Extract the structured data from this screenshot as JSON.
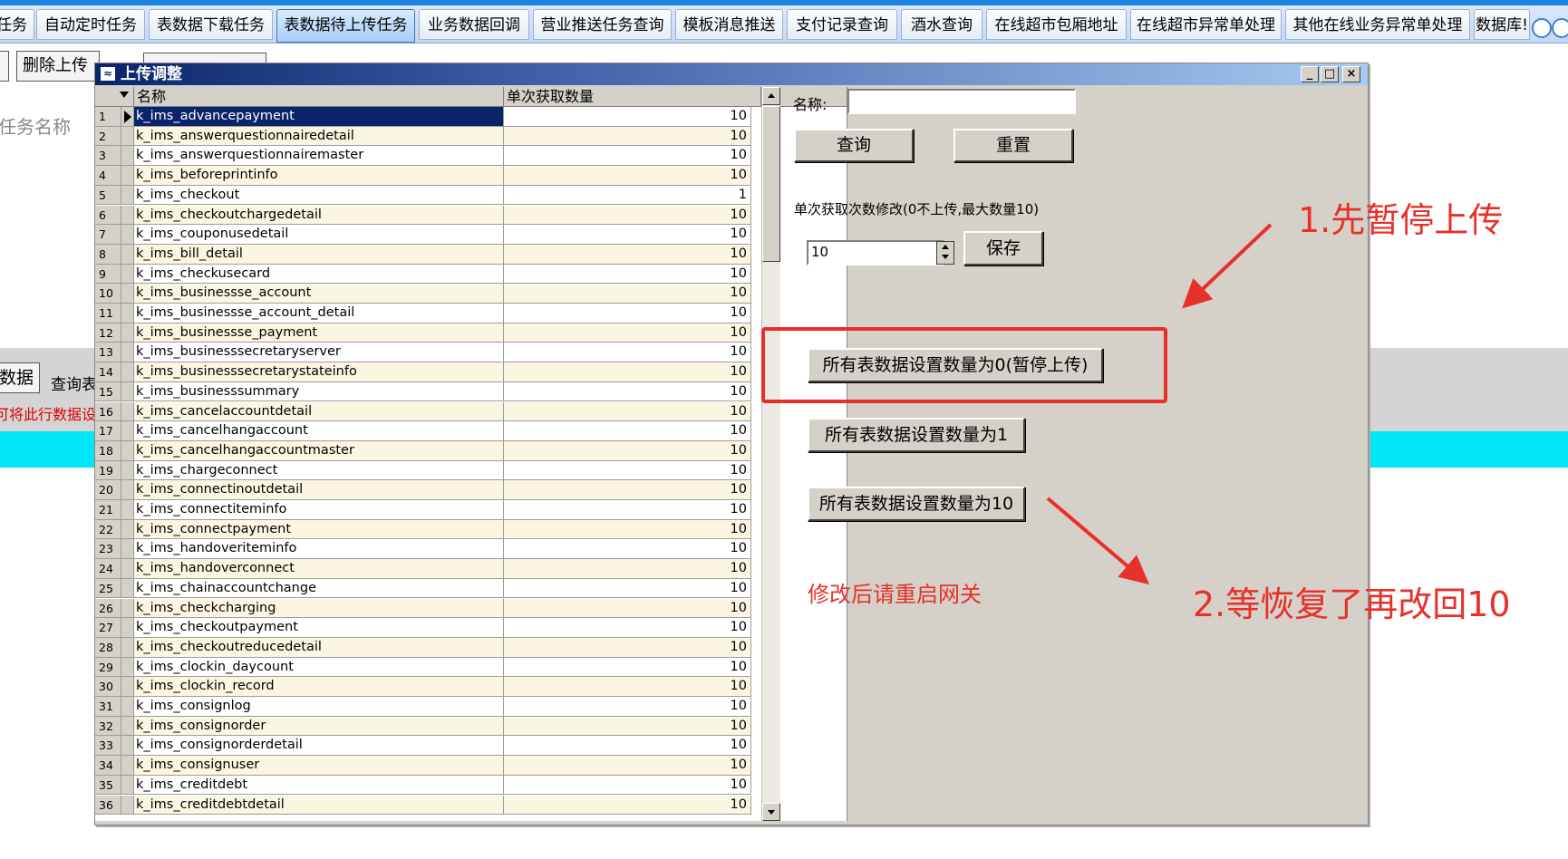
{
  "tabs": [
    {
      "label": "任务"
    },
    {
      "label": "自动定时任务"
    },
    {
      "label": "表数据下载任务"
    },
    {
      "label": "表数据待上传任务"
    },
    {
      "label": "业务数据回调"
    },
    {
      "label": "营业推送任务查询"
    },
    {
      "label": "模板消息推送"
    },
    {
      "label": "支付记录查询"
    },
    {
      "label": "酒水查询"
    },
    {
      "label": "在线超市包厢地址"
    },
    {
      "label": "在线超市异常单处理"
    },
    {
      "label": "其他在线业务异常单处理"
    },
    {
      "label": "数据库!"
    }
  ],
  "background": {
    "delete_upload_button": "删除上传",
    "task_name_label": "任务名称",
    "data_button": "数据",
    "query_table_text": "查询表",
    "warning_text": "可将此行数据设"
  },
  "dialog": {
    "title": "上传调整",
    "columns": {
      "name": "名称",
      "qty": "单次获取数量"
    },
    "rows": [
      {
        "no": "1",
        "name": "k_ims_advancepayment",
        "qty": "10"
      },
      {
        "no": "2",
        "name": "k_ims_answerquestionnairedetail",
        "qty": "10"
      },
      {
        "no": "3",
        "name": "k_ims_answerquestionnairemaster",
        "qty": "10"
      },
      {
        "no": "4",
        "name": "k_ims_beforeprintinfo",
        "qty": "10"
      },
      {
        "no": "5",
        "name": "k_ims_checkout",
        "qty": "1"
      },
      {
        "no": "6",
        "name": "k_ims_checkoutchargedetail",
        "qty": "10"
      },
      {
        "no": "7",
        "name": "k_ims_couponusedetail",
        "qty": "10"
      },
      {
        "no": "8",
        "name": "k_ims_bill_detail",
        "qty": "10"
      },
      {
        "no": "9",
        "name": "k_ims_checkusecard",
        "qty": "10"
      },
      {
        "no": "10",
        "name": "k_ims_businessse_account",
        "qty": "10"
      },
      {
        "no": "11",
        "name": "k_ims_businessse_account_detail",
        "qty": "10"
      },
      {
        "no": "12",
        "name": "k_ims_businessse_payment",
        "qty": "10"
      },
      {
        "no": "13",
        "name": "k_ims_businesssecretaryserver",
        "qty": "10"
      },
      {
        "no": "14",
        "name": "k_ims_businesssecretarystateinfo",
        "qty": "10"
      },
      {
        "no": "15",
        "name": "k_ims_businesssummary",
        "qty": "10"
      },
      {
        "no": "16",
        "name": "k_ims_cancelaccountdetail",
        "qty": "10"
      },
      {
        "no": "17",
        "name": "k_ims_cancelhangaccount",
        "qty": "10"
      },
      {
        "no": "18",
        "name": "k_ims_cancelhangaccountmaster",
        "qty": "10"
      },
      {
        "no": "19",
        "name": "k_ims_chargeconnect",
        "qty": "10"
      },
      {
        "no": "20",
        "name": "k_ims_connectinoutdetail",
        "qty": "10"
      },
      {
        "no": "21",
        "name": "k_ims_connectiteminfo",
        "qty": "10"
      },
      {
        "no": "22",
        "name": "k_ims_connectpayment",
        "qty": "10"
      },
      {
        "no": "23",
        "name": "k_ims_handoveriteminfo",
        "qty": "10"
      },
      {
        "no": "24",
        "name": "k_ims_handoverconnect",
        "qty": "10"
      },
      {
        "no": "25",
        "name": "k_ims_chainaccountchange",
        "qty": "10"
      },
      {
        "no": "26",
        "name": "k_ims_checkcharging",
        "qty": "10"
      },
      {
        "no": "27",
        "name": "k_ims_checkoutpayment",
        "qty": "10"
      },
      {
        "no": "28",
        "name": "k_ims_checkoutreducedetail",
        "qty": "10"
      },
      {
        "no": "29",
        "name": "k_ims_clockin_daycount",
        "qty": "10"
      },
      {
        "no": "30",
        "name": "k_ims_clockin_record",
        "qty": "10"
      },
      {
        "no": "31",
        "name": "k_ims_consignlog",
        "qty": "10"
      },
      {
        "no": "32",
        "name": "k_ims_consignorder",
        "qty": "10"
      },
      {
        "no": "33",
        "name": "k_ims_consignorderdetail",
        "qty": "10"
      },
      {
        "no": "34",
        "name": "k_ims_consignuser",
        "qty": "10"
      },
      {
        "no": "35",
        "name": "k_ims_creditdebt",
        "qty": "10"
      },
      {
        "no": "36",
        "name": "k_ims_creditdebtdetail",
        "qty": "10"
      }
    ],
    "right": {
      "name_label": "名称:",
      "name_value": "",
      "query_button": "查询",
      "reset_button": "重置",
      "modify_label": "单次获取次数修改(0不上传,最大数量10)",
      "qty_value": "10",
      "save_button": "保存",
      "set0_button": "所有表数据设置数量为0(暂停上传)",
      "set1_button": "所有表数据设置数量为1",
      "set10_button": "所有表数据设置数量为10",
      "restart_note": "修改后请重启网关"
    }
  },
  "annotations": {
    "step1": "1.先暂停上传",
    "step2": "2.等恢复了再改回10"
  },
  "colors": {
    "annotation_red": "#e8302a",
    "selection_blue": "#0a246a",
    "alt_row": "#fbf6e1",
    "cyan_strip": "#00e6f6"
  }
}
